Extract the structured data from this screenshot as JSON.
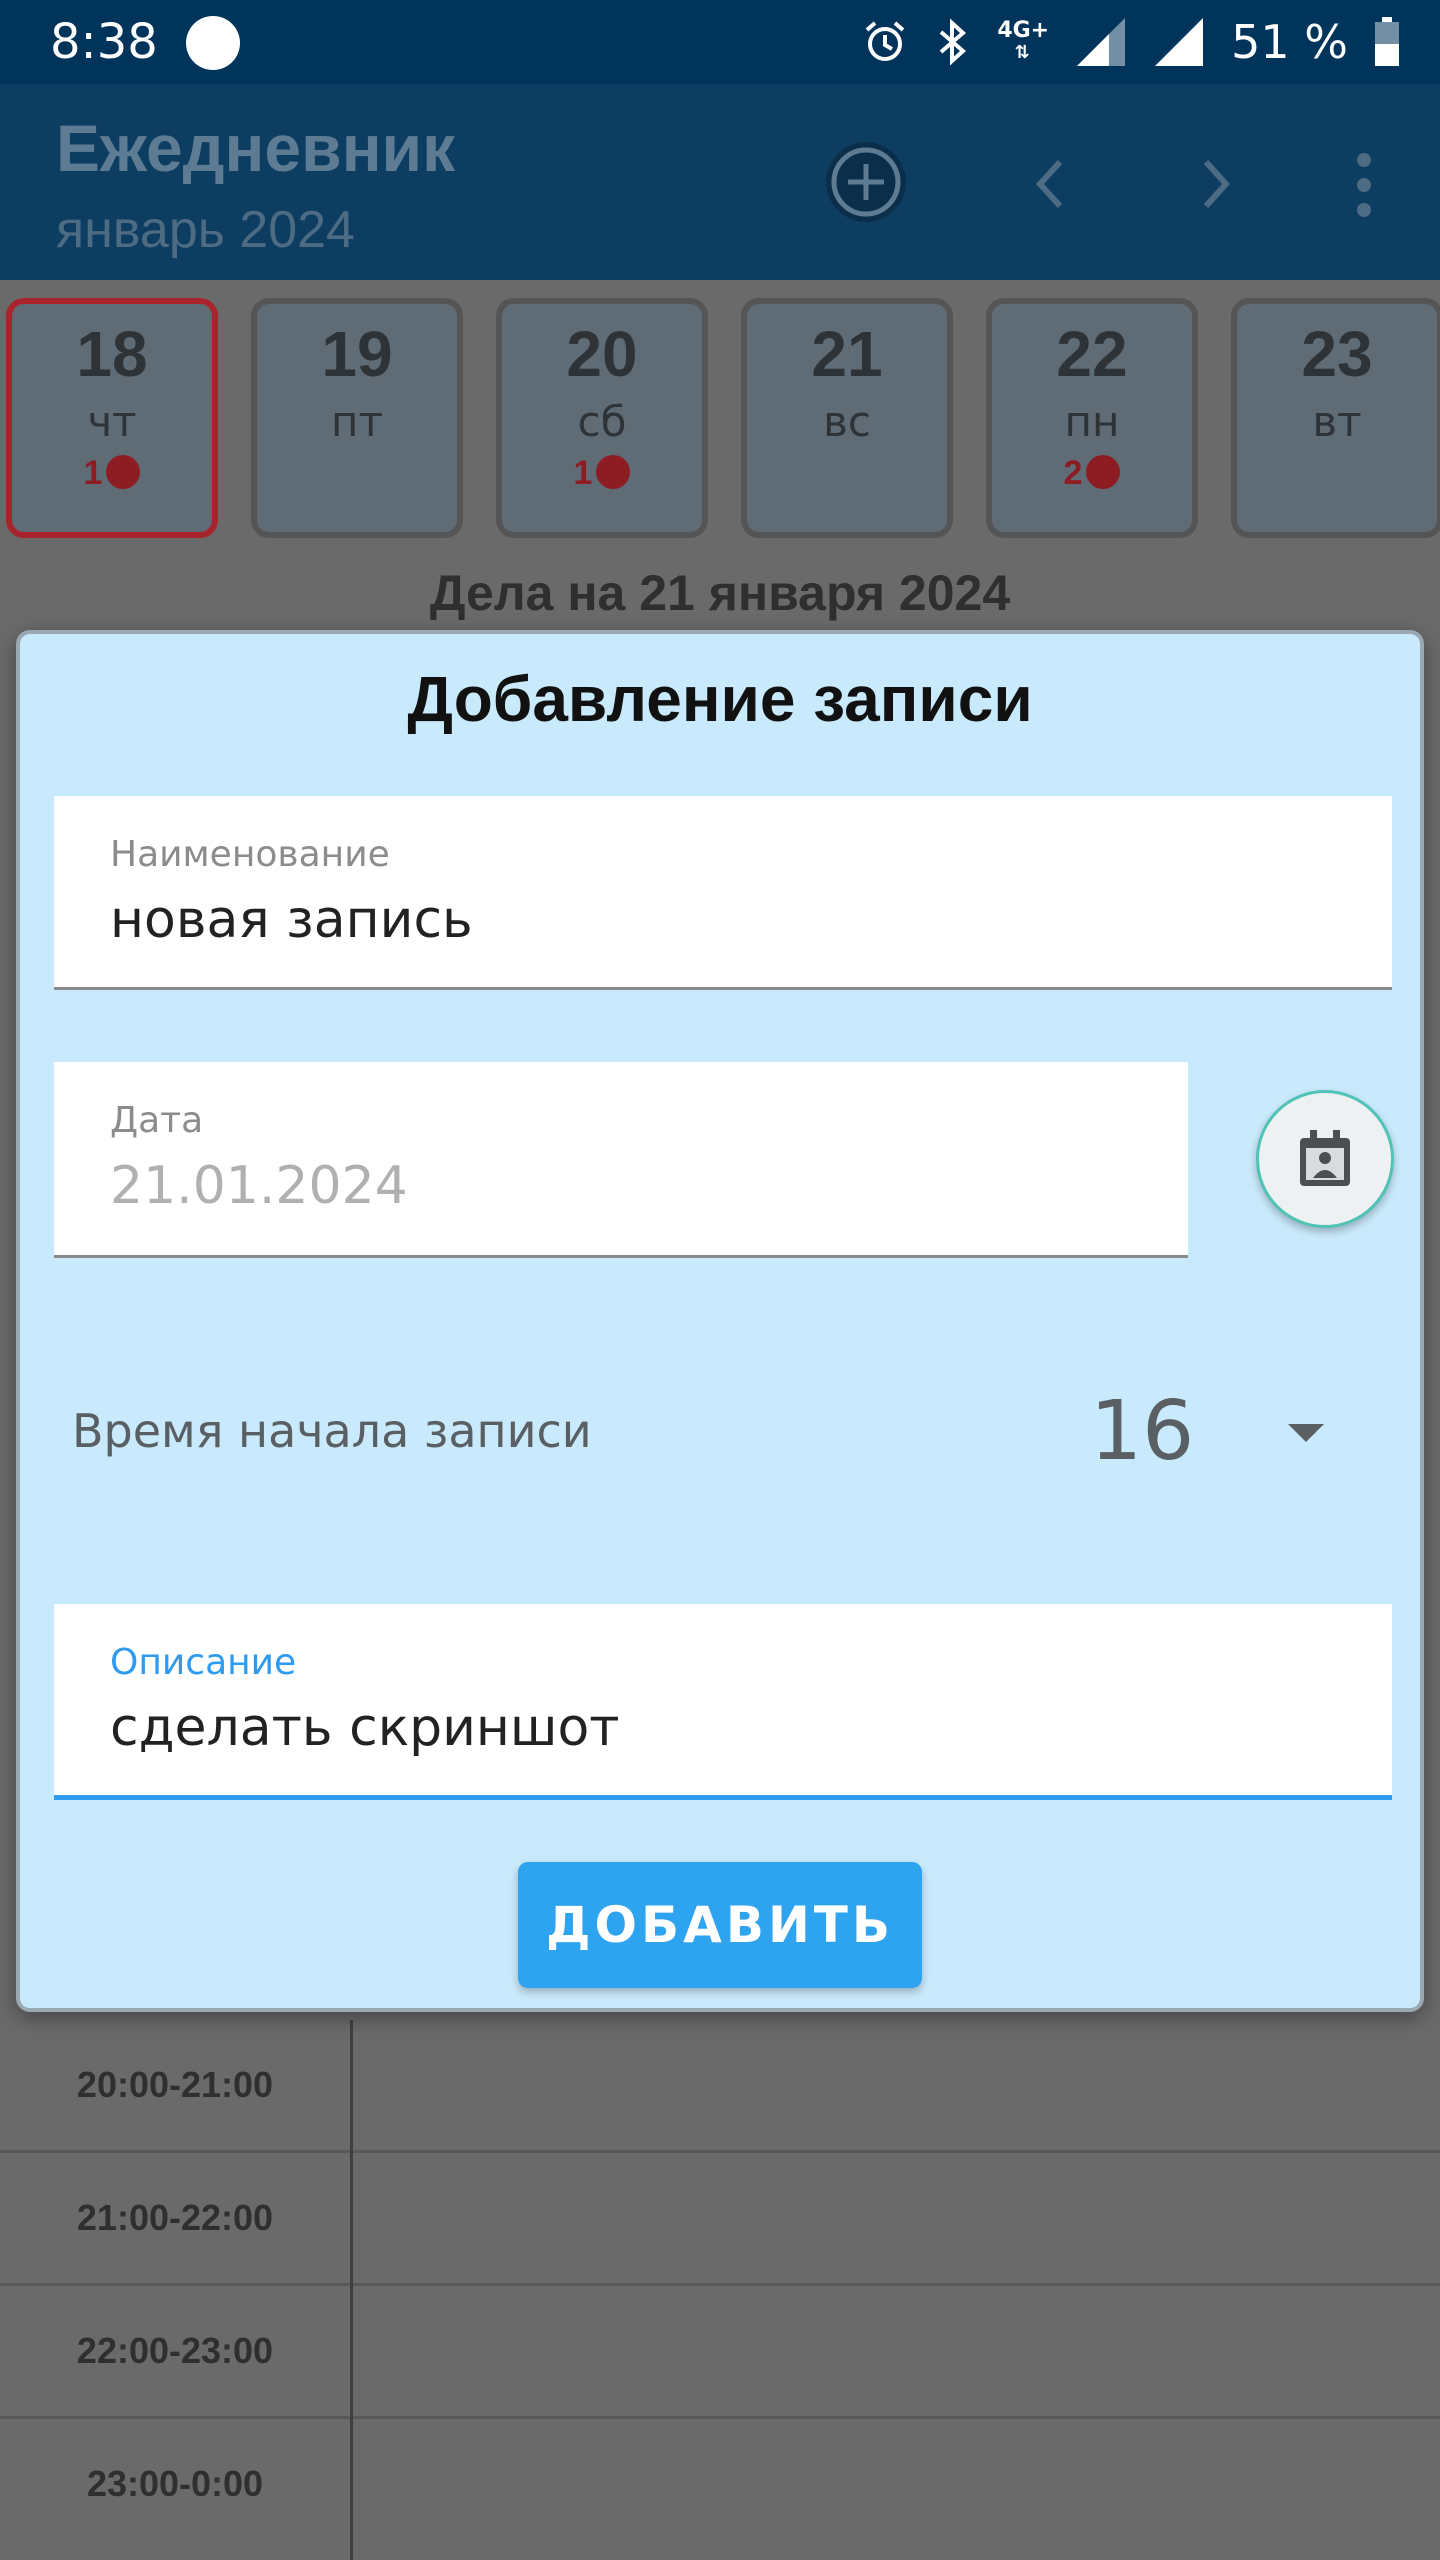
{
  "status_bar": {
    "time": "8:38",
    "network": "4G+",
    "battery": "51 %"
  },
  "app_bar": {
    "title": "Ежедневник",
    "subtitle": "январь 2024",
    "icons": [
      "add-circle-icon",
      "chevron-left-icon",
      "chevron-right-icon",
      "more-vert-icon"
    ]
  },
  "days": [
    {
      "num": "18",
      "weekday": "чт",
      "count": "1",
      "selected": true
    },
    {
      "num": "19",
      "weekday": "пт",
      "count": ""
    },
    {
      "num": "20",
      "weekday": "сб",
      "count": "1"
    },
    {
      "num": "21",
      "weekday": "вс",
      "count": ""
    },
    {
      "num": "22",
      "weekday": "пн",
      "count": "2"
    },
    {
      "num": "23",
      "weekday": "вт",
      "count": ""
    }
  ],
  "tasks_title": "Дела на 21 января 2024",
  "time_slots": [
    "20:00-21:00",
    "21:00-22:00",
    "22:00-23:00",
    "23:00-0:00"
  ],
  "dialog": {
    "title": "Добавление записи",
    "name_label": "Наименование",
    "name_value": "новая запись",
    "date_label": "Дата",
    "date_value": "21.01.2024",
    "calendar_icon": "calendar-contact-icon",
    "time_label": "Время начала записи",
    "time_value": "16",
    "description_label": "Описание",
    "description_value": "сделать скриншот",
    "add_button": "ДОБАВИТЬ"
  },
  "colors": {
    "accent": "#2ea3f0",
    "dialog_bg": "#c9e9fc",
    "status_bar": "#00345b",
    "app_bar": "#0e3d62",
    "event_dot": "#8d1d22"
  }
}
